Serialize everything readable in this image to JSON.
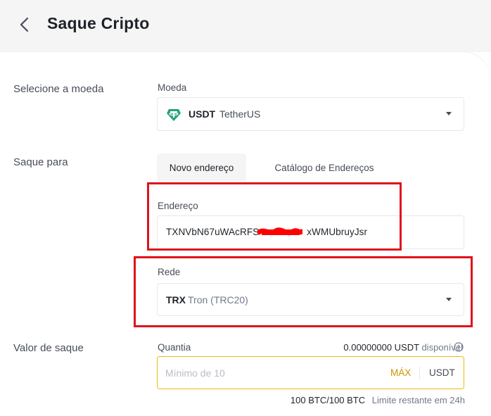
{
  "header": {
    "title": "Saque Cripto",
    "back_icon": "chevron-left-icon"
  },
  "coin_section": {
    "label": "Selecione a moeda",
    "field_label": "Moeda",
    "selected_symbol": "USDT",
    "selected_name": "TetherUS",
    "icon": "tether-icon",
    "icon_color": "#26a17b"
  },
  "withdraw_to": {
    "label": "Saque para",
    "tabs": [
      {
        "label": "Novo endereço",
        "active": true
      },
      {
        "label": "Catálogo de Endereços",
        "active": false
      }
    ]
  },
  "address": {
    "label": "Endereço",
    "value": "TXNVbN67uWAcRFS     xWMUbruyJsr"
  },
  "network": {
    "label": "Rede",
    "symbol": "TRX",
    "name": "Tron (TRC20)"
  },
  "amount": {
    "section_label": "Valor de saque",
    "field_label": "Quantia",
    "available_value": "0.00000000 USDT",
    "available_suffix": "disponível",
    "placeholder": "Mínimo de 10",
    "max_label": "MÁX",
    "unit": "USDT",
    "limit_value": "100 BTC/100 BTC",
    "limit_label": "Limite restante em 24h"
  },
  "colors": {
    "accent": "#f0b90b",
    "max_text": "#c99400",
    "highlight_box": "#e0121b",
    "redaction": "#ff0000"
  }
}
